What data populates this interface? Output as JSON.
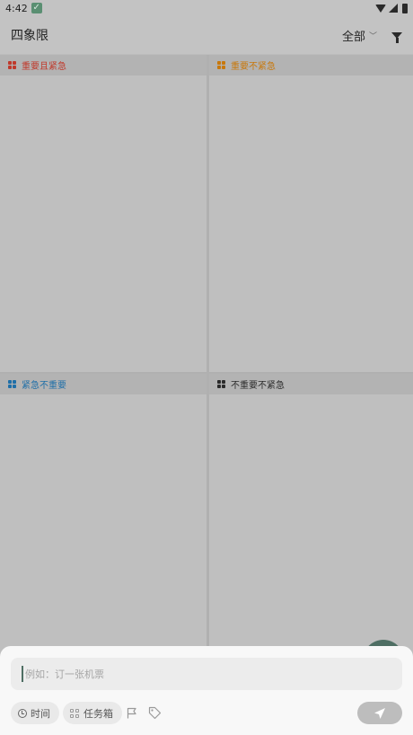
{
  "status_bar": {
    "time": "4:42"
  },
  "app_bar": {
    "title": "四象限",
    "scope": "全部"
  },
  "quadrants": [
    {
      "label": "重要且紧急",
      "color": "#c0392b"
    },
    {
      "label": "重要不紧急",
      "color": "#c8780c"
    },
    {
      "label": "紧急不重要",
      "color": "#1f6fa8"
    },
    {
      "label": "不重要不紧急",
      "color": "#2b2b2b"
    }
  ],
  "composer": {
    "placeholder": "例如：订一张机票",
    "time_chip": "时间",
    "inbox_chip": "任务箱"
  },
  "colors": {
    "accent": "#4e6e63"
  }
}
